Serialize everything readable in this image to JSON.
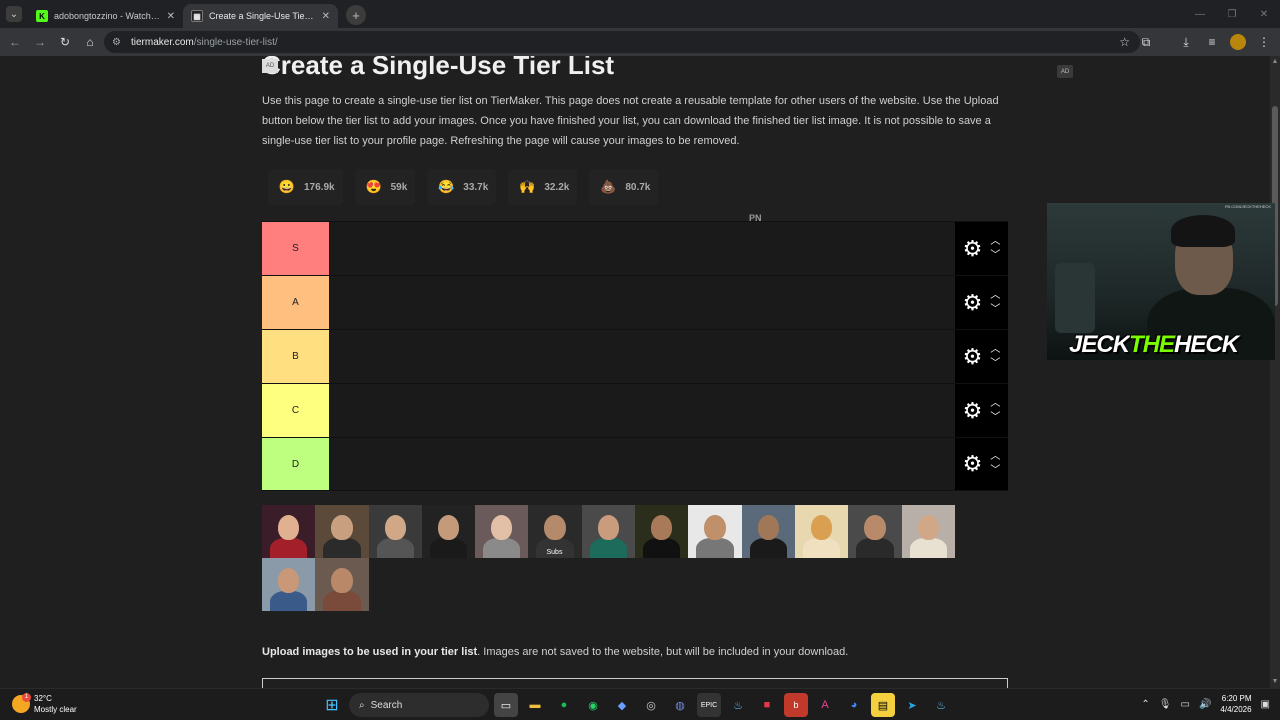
{
  "browser": {
    "tabs": [
      {
        "label": "adobongtozzino - Watch the V",
        "favicon": "K",
        "active": false
      },
      {
        "label": "Create a Single-Use Tier List (P",
        "favicon": "TM",
        "active": true
      }
    ],
    "new_tab_label": "+",
    "address": {
      "host": "tiermaker.com",
      "path": "/single-use-tier-list/"
    }
  },
  "page": {
    "ad_small": "AD",
    "ad_right": "AD",
    "title": "Create a Single-Use Tier List",
    "intro": "Use this page to create a single-use tier list on TierMaker. This page does not create a reusable template for other users of the website. Use the Upload button below the tier list to add your images. Once you have finished your list, you can download the finished tier list image. It is not possible to save a single-use tier list to your profile page. Refreshing the page will cause your images to be removed.",
    "reactions": [
      {
        "emoji": "😀",
        "count": "176.9k"
      },
      {
        "emoji": "😍",
        "count": "59k"
      },
      {
        "emoji": "😂",
        "count": "33.7k"
      },
      {
        "emoji": "🙌",
        "count": "32.2k"
      },
      {
        "emoji": "💩",
        "count": "80.7k"
      }
    ],
    "pn_text": "PN",
    "tiers": [
      {
        "label": "S",
        "color": "#ff7f7f"
      },
      {
        "label": "A",
        "color": "#ffbf7f"
      },
      {
        "label": "B",
        "color": "#ffdf7f"
      },
      {
        "label": "C",
        "color": "#ffff7f"
      },
      {
        "label": "D",
        "color": "#bfff7f"
      }
    ],
    "pool_caption": "Subs",
    "upload_bold": "Upload images to be used in your tier list",
    "upload_rest": ". Images are not saved to the website, but will be included in your download."
  },
  "webcam": {
    "url": "FB.COM/JECKTHEHECK",
    "brand_a": "JECK",
    "brand_b": "THE",
    "brand_c": "HECK"
  },
  "taskbar": {
    "weather_temp": "32°C",
    "weather_desc": "Mostly clear",
    "weather_badge": "1",
    "search_label": "Search",
    "time": "6:20 PM",
    "date": "4/4/2026"
  }
}
